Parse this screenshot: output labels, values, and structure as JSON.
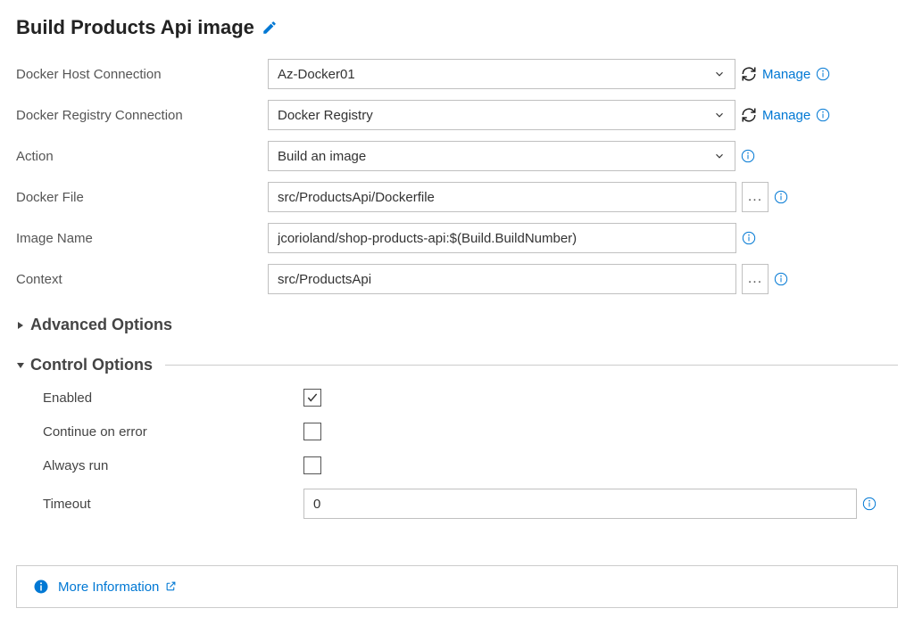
{
  "header": {
    "title": "Build Products Api image"
  },
  "rows": {
    "dockerHost": {
      "label": "Docker Host Connection",
      "value": "Az-Docker01",
      "manage": "Manage"
    },
    "dockerRegistry": {
      "label": "Docker Registry Connection",
      "value": "Docker Registry",
      "manage": "Manage"
    },
    "action": {
      "label": "Action",
      "value": "Build an image"
    },
    "dockerFile": {
      "label": "Docker File",
      "value": "src/ProductsApi/Dockerfile"
    },
    "imageName": {
      "label": "Image Name",
      "value": "jcorioland/shop-products-api:$(Build.BuildNumber)"
    },
    "context": {
      "label": "Context",
      "value": "src/ProductsApi"
    }
  },
  "sections": {
    "advanced": {
      "title": "Advanced Options",
      "expanded": false
    },
    "control": {
      "title": "Control Options",
      "expanded": true,
      "enabled": {
        "label": "Enabled",
        "checked": true
      },
      "continueOnError": {
        "label": "Continue on error",
        "checked": false
      },
      "alwaysRun": {
        "label": "Always run",
        "checked": false
      },
      "timeout": {
        "label": "Timeout",
        "value": "0"
      }
    }
  },
  "moreInfo": {
    "label": "More Information"
  },
  "icons": {
    "ellipsis": "..."
  }
}
